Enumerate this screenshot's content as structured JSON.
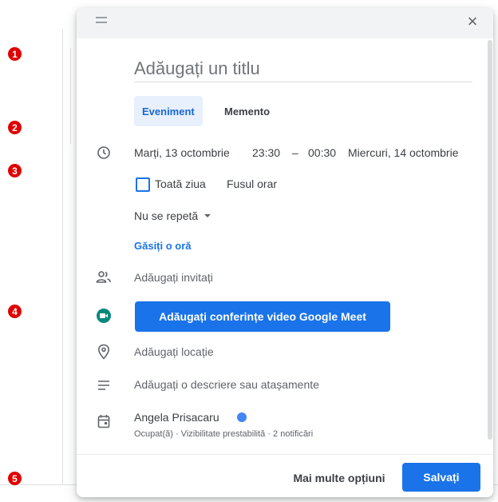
{
  "markers": [
    "1",
    "2",
    "3",
    "4",
    "5"
  ],
  "title_input": {
    "placeholder": "Adăugați un titlu"
  },
  "tabs": {
    "event": "Eveniment",
    "reminder": "Memento"
  },
  "datetime": {
    "start_date": "Marți, 13 octombrie",
    "start_time": "23:30",
    "dash": "–",
    "end_time": "00:30",
    "end_date": "Miercuri, 14 octombrie"
  },
  "all_day": {
    "label": "Toată ziua",
    "checked": false
  },
  "timezone_label": "Fusul orar",
  "repeat": {
    "label": "Nu se repetă"
  },
  "find_time": "Găsiți o oră",
  "guests": "Adăugați invitați",
  "meet_button": "Adăugați conferințe video Google Meet",
  "location": "Adăugați locație",
  "description": "Adăugați o descriere sau atașamente",
  "calendar": {
    "owner": "Angela Prisacaru",
    "details": "Ocupat(ă) · Vizibilitate prestabilită · 2 notificări",
    "color": "#4285f4"
  },
  "footer": {
    "more": "Mai multe opțiuni",
    "save": "Salvați"
  },
  "colors": {
    "accent": "#1a73e8",
    "marker": "#e00000",
    "tab_active_bg": "#e8f0fe",
    "meet_icon": "#00897b"
  },
  "icons": [
    "drag-handle-icon",
    "close-icon",
    "clock-icon",
    "chevron-down-icon",
    "people-icon",
    "google-meet-icon",
    "location-pin-icon",
    "notes-icon",
    "calendar-icon"
  ]
}
